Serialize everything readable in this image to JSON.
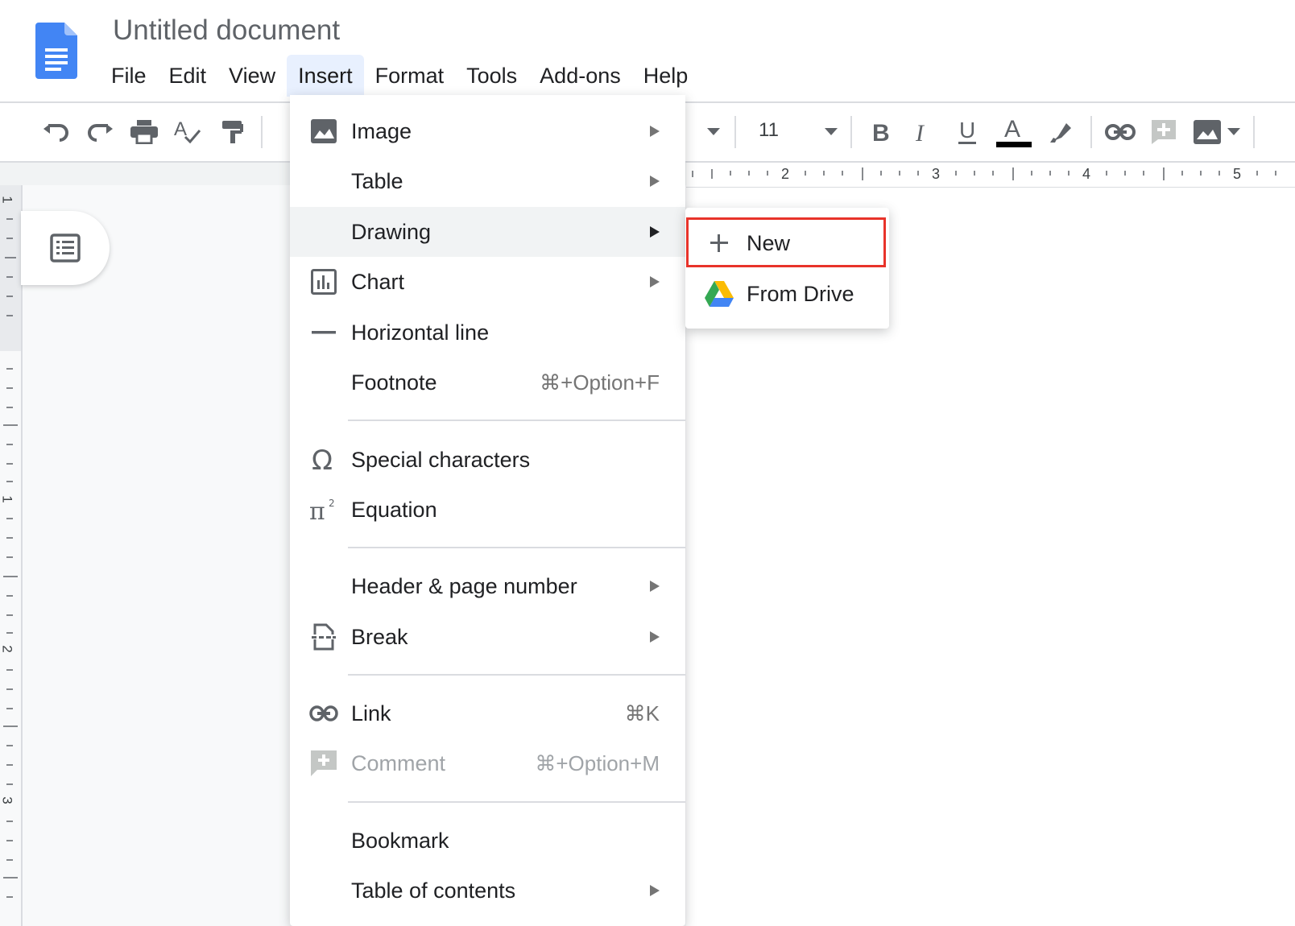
{
  "document": {
    "title": "Untitled document"
  },
  "menubar": {
    "items": [
      {
        "label": "File"
      },
      {
        "label": "Edit"
      },
      {
        "label": "View"
      },
      {
        "label": "Insert",
        "active": true
      },
      {
        "label": "Format"
      },
      {
        "label": "Tools"
      },
      {
        "label": "Add-ons"
      },
      {
        "label": "Help"
      }
    ]
  },
  "toolbar": {
    "font_size": "11",
    "icons": [
      "undo-icon",
      "redo-icon",
      "print-icon",
      "spellcheck-icon",
      "paint-format-icon",
      "bold-icon",
      "italic-icon",
      "underline-icon",
      "text-color-icon",
      "highlight-icon",
      "link-icon",
      "add-comment-icon",
      "insert-image-icon"
    ],
    "text_color": "#000000"
  },
  "ruler": {
    "horizontal_numbers": [
      "2",
      "3",
      "4",
      "5"
    ],
    "vertical_numbers": [
      "1",
      "1",
      "2",
      "3"
    ]
  },
  "insert_menu": {
    "items": [
      {
        "label": "Image",
        "icon": "image-icon",
        "submenu": true
      },
      {
        "label": "Table",
        "submenu": true
      },
      {
        "label": "Drawing",
        "submenu": true,
        "hovered": true
      },
      {
        "label": "Chart",
        "icon": "chart-icon",
        "submenu": true
      },
      {
        "label": "Horizontal line",
        "icon": "horizontal-line-icon"
      },
      {
        "label": "Footnote",
        "shortcut": "⌘+Option+F"
      },
      {
        "label": "Special characters",
        "icon": "omega-icon"
      },
      {
        "label": "Equation",
        "icon": "pi-icon"
      },
      {
        "label": "Header & page number",
        "submenu": true
      },
      {
        "label": "Break",
        "icon": "page-break-icon",
        "submenu": true
      },
      {
        "label": "Link",
        "icon": "link-icon",
        "shortcut": "⌘K"
      },
      {
        "label": "Comment",
        "icon": "comment-icon",
        "shortcut": "⌘+Option+M",
        "disabled": true
      },
      {
        "label": "Bookmark"
      },
      {
        "label": "Table of contents",
        "submenu": true
      }
    ]
  },
  "drawing_submenu": {
    "items": [
      {
        "label": "New",
        "icon": "plus-icon",
        "highlighted": true
      },
      {
        "label": "From Drive",
        "icon": "google-drive-icon"
      }
    ],
    "highlight_color": "#e8332a"
  },
  "colors": {
    "accent_blue": "#4285f4",
    "menu_active_bg": "#e8f0fe",
    "hover_bg": "#f1f3f4"
  }
}
